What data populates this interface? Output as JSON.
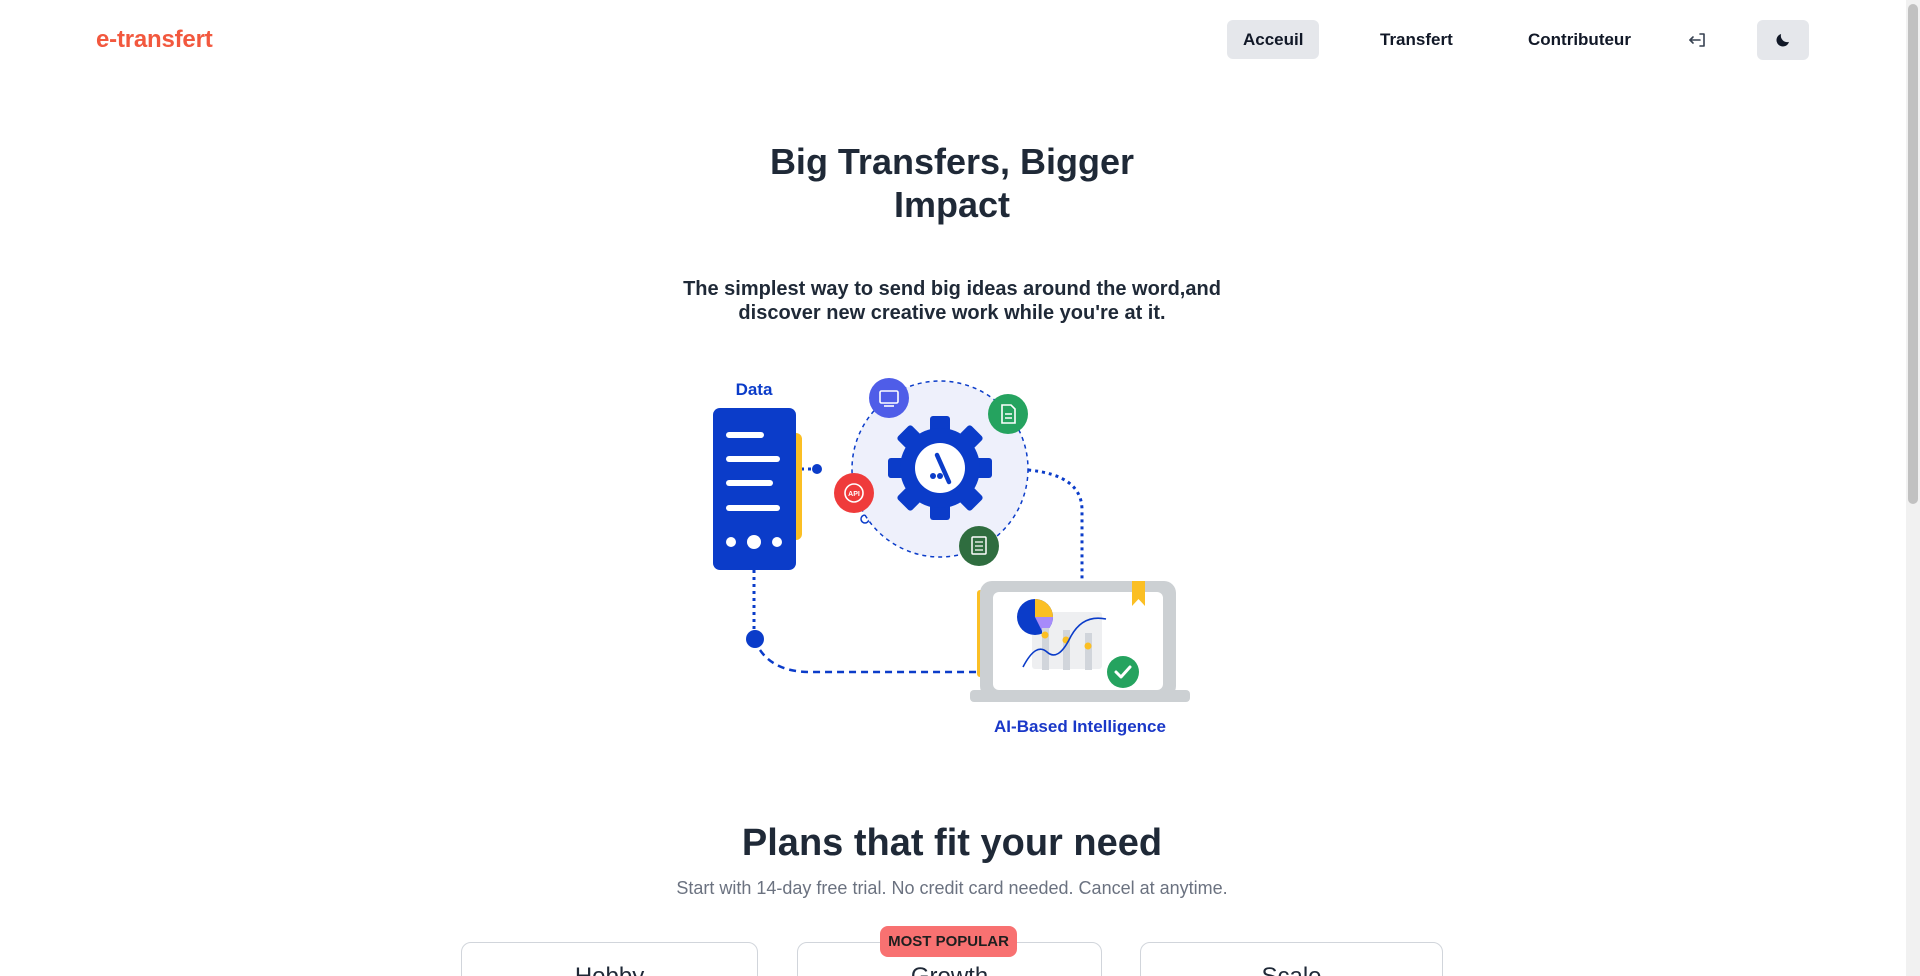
{
  "brand": {
    "name": "e-transfert",
    "color": "#f2583e"
  },
  "nav": {
    "items": [
      {
        "label": "Acceuil",
        "active": true
      },
      {
        "label": "Transfert",
        "active": false
      },
      {
        "label": "Contributeur",
        "active": false
      }
    ],
    "login_icon": "login-icon",
    "theme_icon": "moon-icon"
  },
  "hero": {
    "title": "Big Transfers, Bigger Impact",
    "subtitle": "The simplest way to send big ideas around the word,and discover new creative work while you're at it.",
    "illustration": {
      "data_label": "Data",
      "ai_label": "AI-Based Intelligence",
      "icons": [
        "monitor-icon",
        "document-icon",
        "api-icon",
        "spreadsheet-icon",
        "gear-icon",
        "pie-chart-icon",
        "checkmark-icon",
        "bookmark-icon"
      ]
    }
  },
  "plans": {
    "title": "Plans that fit your need",
    "subtitle": "Start with 14-day free trial. No credit card needed. Cancel at anytime.",
    "badge": "MOST POPULAR",
    "cards": [
      {
        "name": "Hobby"
      },
      {
        "name": "Growth"
      },
      {
        "name": "Scale"
      }
    ]
  },
  "colors": {
    "accent_blue": "#0b3cc9",
    "badge_red": "#f87171",
    "nav_active_bg": "#e5e7eb"
  }
}
